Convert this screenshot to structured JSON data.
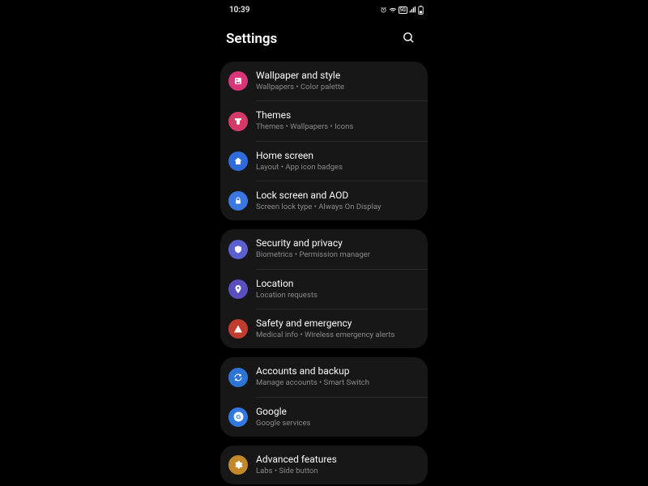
{
  "status": {
    "time": "10:39"
  },
  "header": {
    "title": "Settings"
  },
  "groups": [
    {
      "items": [
        {
          "id": "wallpaper",
          "title": "Wallpaper and style",
          "sub": "Wallpapers  •  Color palette"
        },
        {
          "id": "themes",
          "title": "Themes",
          "sub": "Themes  •  Wallpapers  •  Icons"
        },
        {
          "id": "home",
          "title": "Home screen",
          "sub": "Layout  •  App icon badges"
        },
        {
          "id": "lock",
          "title": "Lock screen and AOD",
          "sub": "Screen lock type  •  Always On Display"
        }
      ]
    },
    {
      "items": [
        {
          "id": "security",
          "title": "Security and privacy",
          "sub": "Biometrics  •  Permission manager"
        },
        {
          "id": "location",
          "title": "Location",
          "sub": "Location requests"
        },
        {
          "id": "safety",
          "title": "Safety and emergency",
          "sub": "Medical info  •  Wireless emergency alerts"
        }
      ]
    },
    {
      "items": [
        {
          "id": "accounts",
          "title": "Accounts and backup",
          "sub": "Manage accounts  •  Smart Switch"
        },
        {
          "id": "google",
          "title": "Google",
          "sub": "Google services"
        }
      ]
    },
    {
      "items": [
        {
          "id": "advanced",
          "title": "Advanced features",
          "sub": "Labs  •  Side button"
        }
      ]
    }
  ]
}
